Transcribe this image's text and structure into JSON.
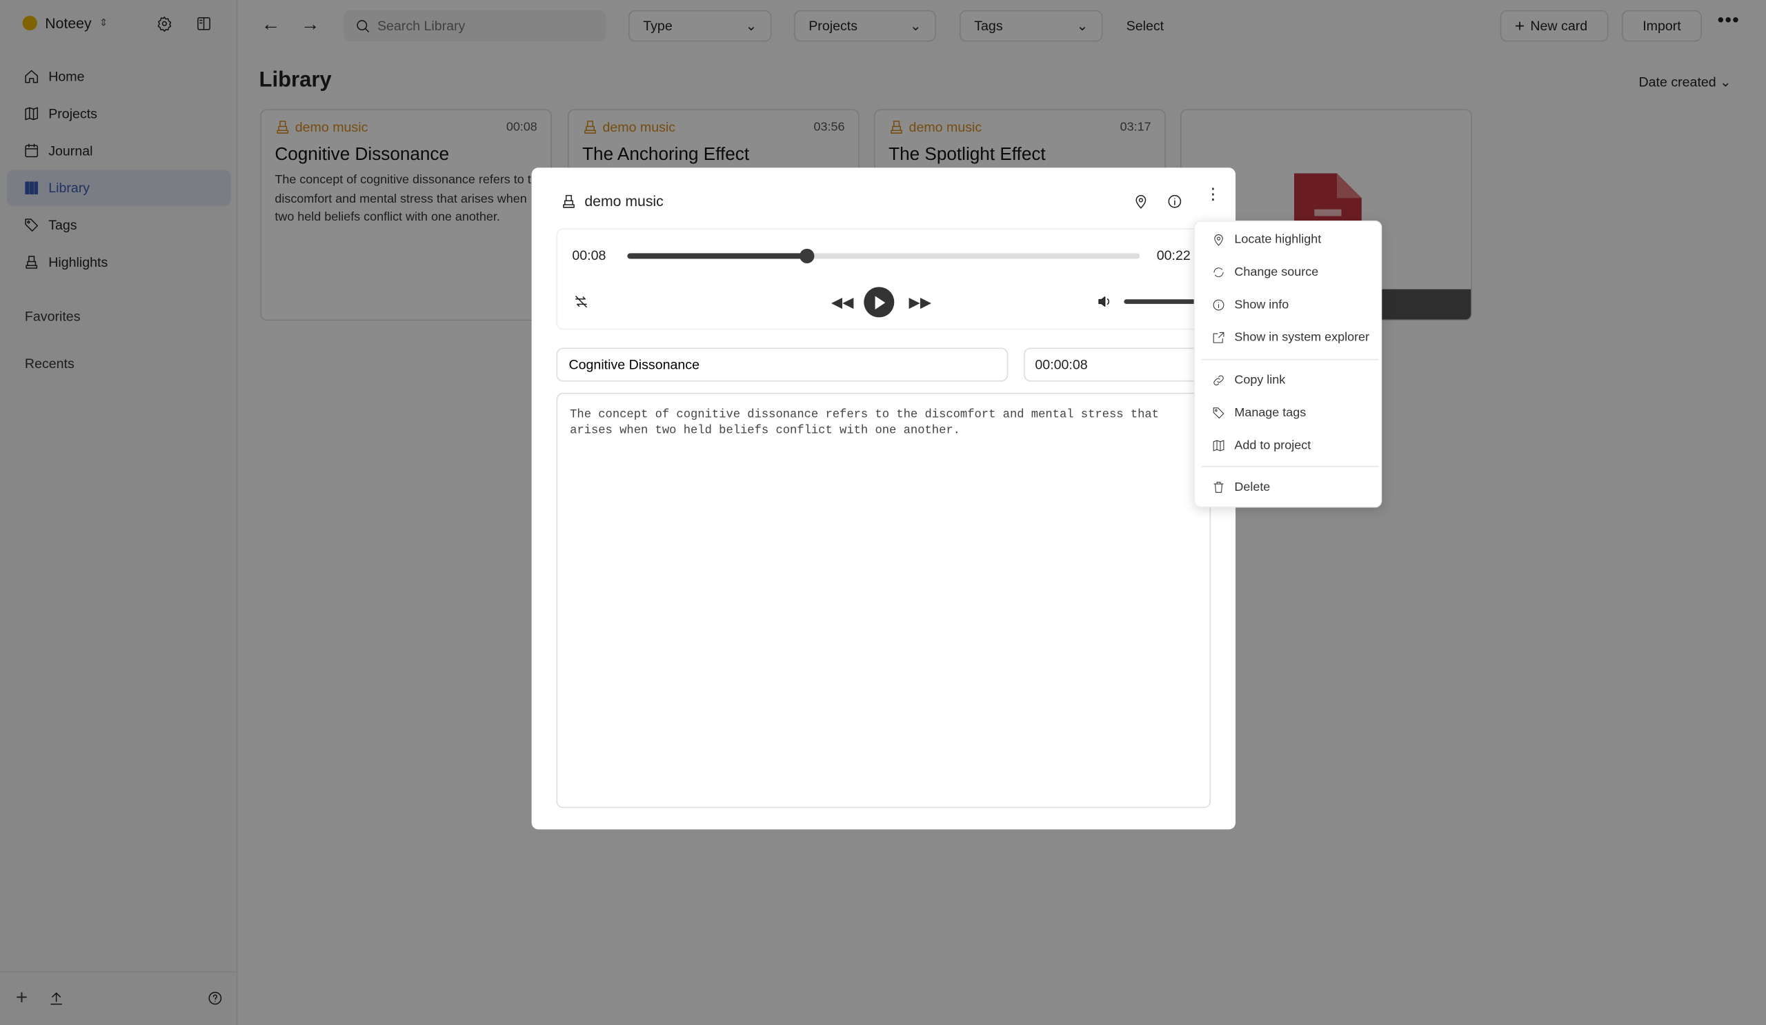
{
  "app": {
    "name": "Noteey"
  },
  "search": {
    "placeholder": "Search Library"
  },
  "filters": {
    "type": "Type",
    "projects": "Projects",
    "tags": "Tags",
    "select": "Select"
  },
  "toolbar": {
    "new_card": "New card",
    "import": "Import"
  },
  "sidebar": {
    "items": [
      {
        "label": "Home",
        "icon": "home-icon"
      },
      {
        "label": "Projects",
        "icon": "map-icon"
      },
      {
        "label": "Journal",
        "icon": "calendar-icon"
      },
      {
        "label": "Library",
        "icon": "library-icon",
        "active": true
      },
      {
        "label": "Tags",
        "icon": "tag-icon"
      },
      {
        "label": "Highlights",
        "icon": "highlighter-icon"
      }
    ],
    "favorites": "Favorites",
    "recents": "Recents"
  },
  "main": {
    "title": "Library",
    "sort": "Date created"
  },
  "cards": [
    {
      "source": "demo music",
      "duration": "00:08",
      "title": "Cognitive Dissonance",
      "description": "The concept of cognitive dissonance refers to the discomfort and mental stress that arises when two held beliefs conflict with one another."
    },
    {
      "source": "demo music",
      "duration": "03:56",
      "title": "The Anchoring Effect"
    },
    {
      "source": "demo music",
      "duration": "03:17",
      "title": "The Spotlight Effect"
    },
    {
      "type": "pdf-file"
    }
  ],
  "modal": {
    "source": "demo music",
    "player": {
      "current": "00:08",
      "total": "00:22",
      "progress": 0.35,
      "volume": 1.0
    },
    "title_value": "Cognitive Dissonance",
    "timestamp_value": "00:00:08",
    "note": "The concept of cognitive dissonance refers to the discomfort and mental stress that arises when two held beliefs conflict with one another."
  },
  "context_menu": {
    "items": [
      "Locate highlight",
      "Change source",
      "Show info",
      "Show in system explorer",
      "Copy link",
      "Manage tags",
      "Add to project",
      "Delete"
    ]
  },
  "colors": {
    "accent": "#3b5bb5",
    "source": "#d98a1c",
    "pdf": "#c0363f"
  }
}
